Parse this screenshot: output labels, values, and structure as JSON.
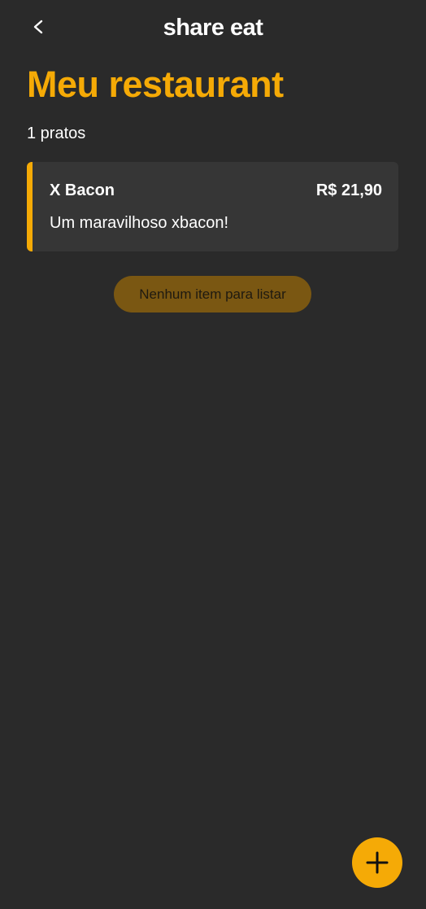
{
  "header": {
    "back_icon": "chevron-left-icon",
    "app_title": "share eat"
  },
  "page": {
    "title": "Meu restaurant",
    "dish_count": "1 pratos"
  },
  "dishes": [
    {
      "name": "X Bacon",
      "price": "R$ 21,90",
      "description": "Um maravilhoso xbacon!"
    }
  ],
  "empty_state": {
    "message": "Nenhum item para listar"
  },
  "fab": {
    "icon": "plus-icon"
  },
  "colors": {
    "background": "#2a2a2a",
    "card": "#363636",
    "accent": "#f5aa06",
    "empty_pill": "#7a5712"
  }
}
